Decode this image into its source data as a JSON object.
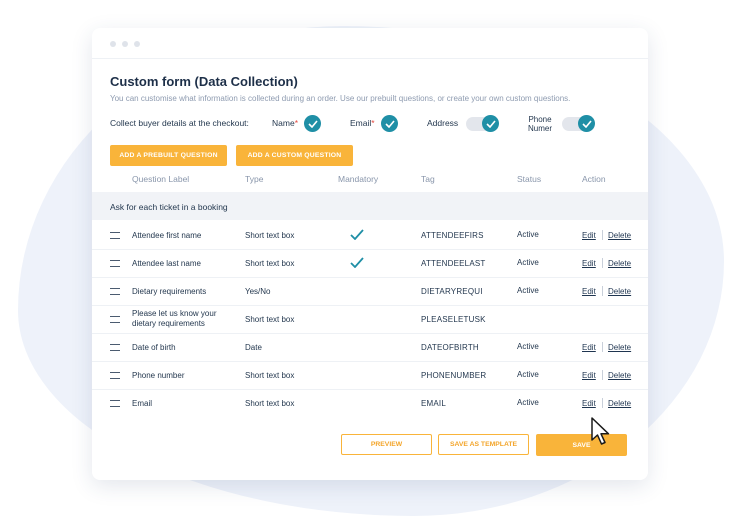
{
  "form": {
    "title": "Custom form (Data Collection)",
    "subtitle": "You can customise what information is collected during an order. Use our prebuilt questions, or create your own custom questions.",
    "collect_label": "Collect buyer details at the checkout:",
    "options": [
      {
        "label": "Name",
        "required": "*",
        "checked": true
      },
      {
        "label": "Email",
        "required": "*",
        "checked": true
      },
      {
        "label": "Address",
        "checked": true
      },
      {
        "label_line1": "Phone",
        "label_line2": "Numer",
        "checked": true
      }
    ],
    "buttons": {
      "prebuilt": "ADD A PREBUILT QUESTION",
      "custom": "ADD A CUSTOM QUESTION"
    }
  },
  "table": {
    "headers": [
      "Question Label",
      "Type",
      "Mandatory",
      "Tag",
      "Status",
      "Action"
    ],
    "group_label": "Ask for each ticket in a booking",
    "edit_label": "Edit",
    "delete_label": "Delete",
    "rows": [
      {
        "label": "Attendee first name",
        "type": "Short text box",
        "mandatory": true,
        "tag": "ATTENDEEFIRS",
        "status": "Active",
        "actions": true
      },
      {
        "label": "Attendee last name",
        "type": "Short text box",
        "mandatory": true,
        "tag": "ATTENDEELAST",
        "status": "Active",
        "actions": true
      },
      {
        "label": "Dietary requirements",
        "type": "Yes/No",
        "mandatory": false,
        "tag": "DIETARYREQUI",
        "status": "Active",
        "actions": true
      },
      {
        "label": "Please let us know your dietary requirements",
        "type": "Short text box",
        "mandatory": false,
        "tag": "PLEASELETUSK",
        "status": "",
        "actions": false
      },
      {
        "label": "Date of birth",
        "type": "Date",
        "mandatory": false,
        "tag": "DATEOFBIRTH",
        "status": "Active",
        "actions": true
      },
      {
        "label": "Phone number",
        "type": "Short text box",
        "mandatory": false,
        "tag": "PHONENUMBER",
        "status": "Active",
        "actions": true
      },
      {
        "label": "Email",
        "type": "Short text box",
        "mandatory": false,
        "tag": "EMAIL",
        "status": "Active",
        "actions": true
      }
    ]
  },
  "footer": {
    "preview": "PREVIEW",
    "save_template": "SAVE AS TEMPLATE",
    "save": "SAVE"
  },
  "colors": {
    "accent": "#f9b43a",
    "check": "#1f8fa6",
    "background_blob": "#eef2fa"
  },
  "icons": [
    "drag-handle-icon",
    "check-icon",
    "cursor-arrow-icon"
  ]
}
